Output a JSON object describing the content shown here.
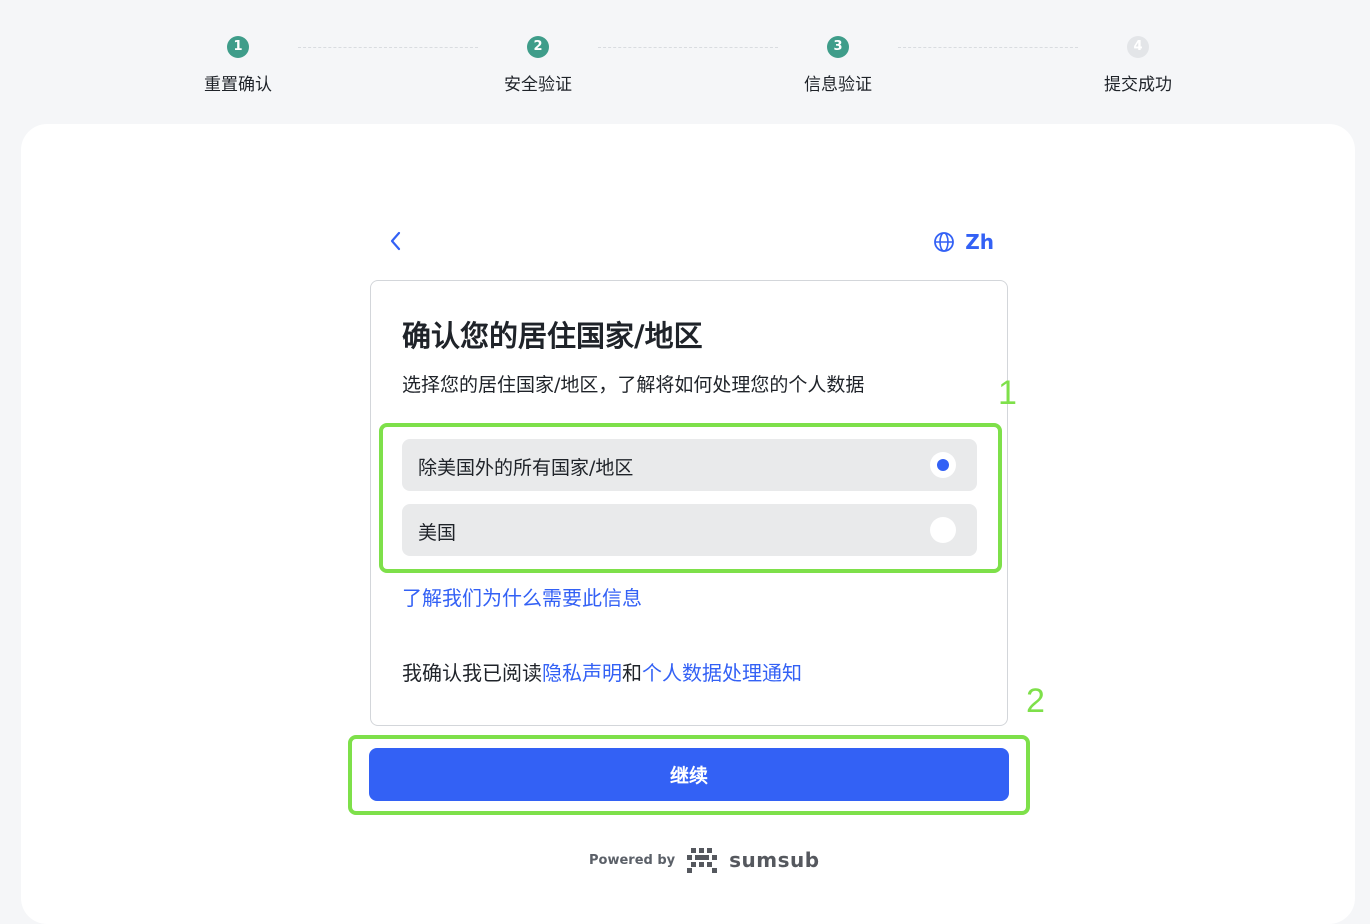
{
  "stepper": {
    "steps": [
      {
        "num": "1",
        "label": "重置确认",
        "state": "done"
      },
      {
        "num": "2",
        "label": "安全验证",
        "state": "done"
      },
      {
        "num": "3",
        "label": "信息验证",
        "state": "active"
      },
      {
        "num": "4",
        "label": "提交成功",
        "state": "pending"
      }
    ]
  },
  "topbar": {
    "back_icon": "chevron-left-icon",
    "lang_icon": "globe-icon",
    "lang_label": "Zh"
  },
  "form": {
    "title": "确认您的居住国家/地区",
    "subtitle": "选择您的居住国家/地区，了解将如何处理您的个人数据",
    "options": [
      {
        "label": "除美国外的所有国家/地区",
        "selected": true
      },
      {
        "label": "美国",
        "selected": false
      }
    ],
    "why_link": "了解我们为什么需要此信息",
    "consent": {
      "prefix": "我确认我已阅读",
      "privacy_link": "隐私声明",
      "and": "和",
      "notice_link": "个人数据处理通知"
    }
  },
  "continue_label": "继续",
  "footer": {
    "powered_by": "Powered by",
    "brand": "sumsub"
  },
  "annotations": {
    "one": "1",
    "two": "2"
  },
  "colors": {
    "accent": "#3361f5",
    "step_done": "#3f9d8a",
    "annotation": "#7ee04a"
  }
}
